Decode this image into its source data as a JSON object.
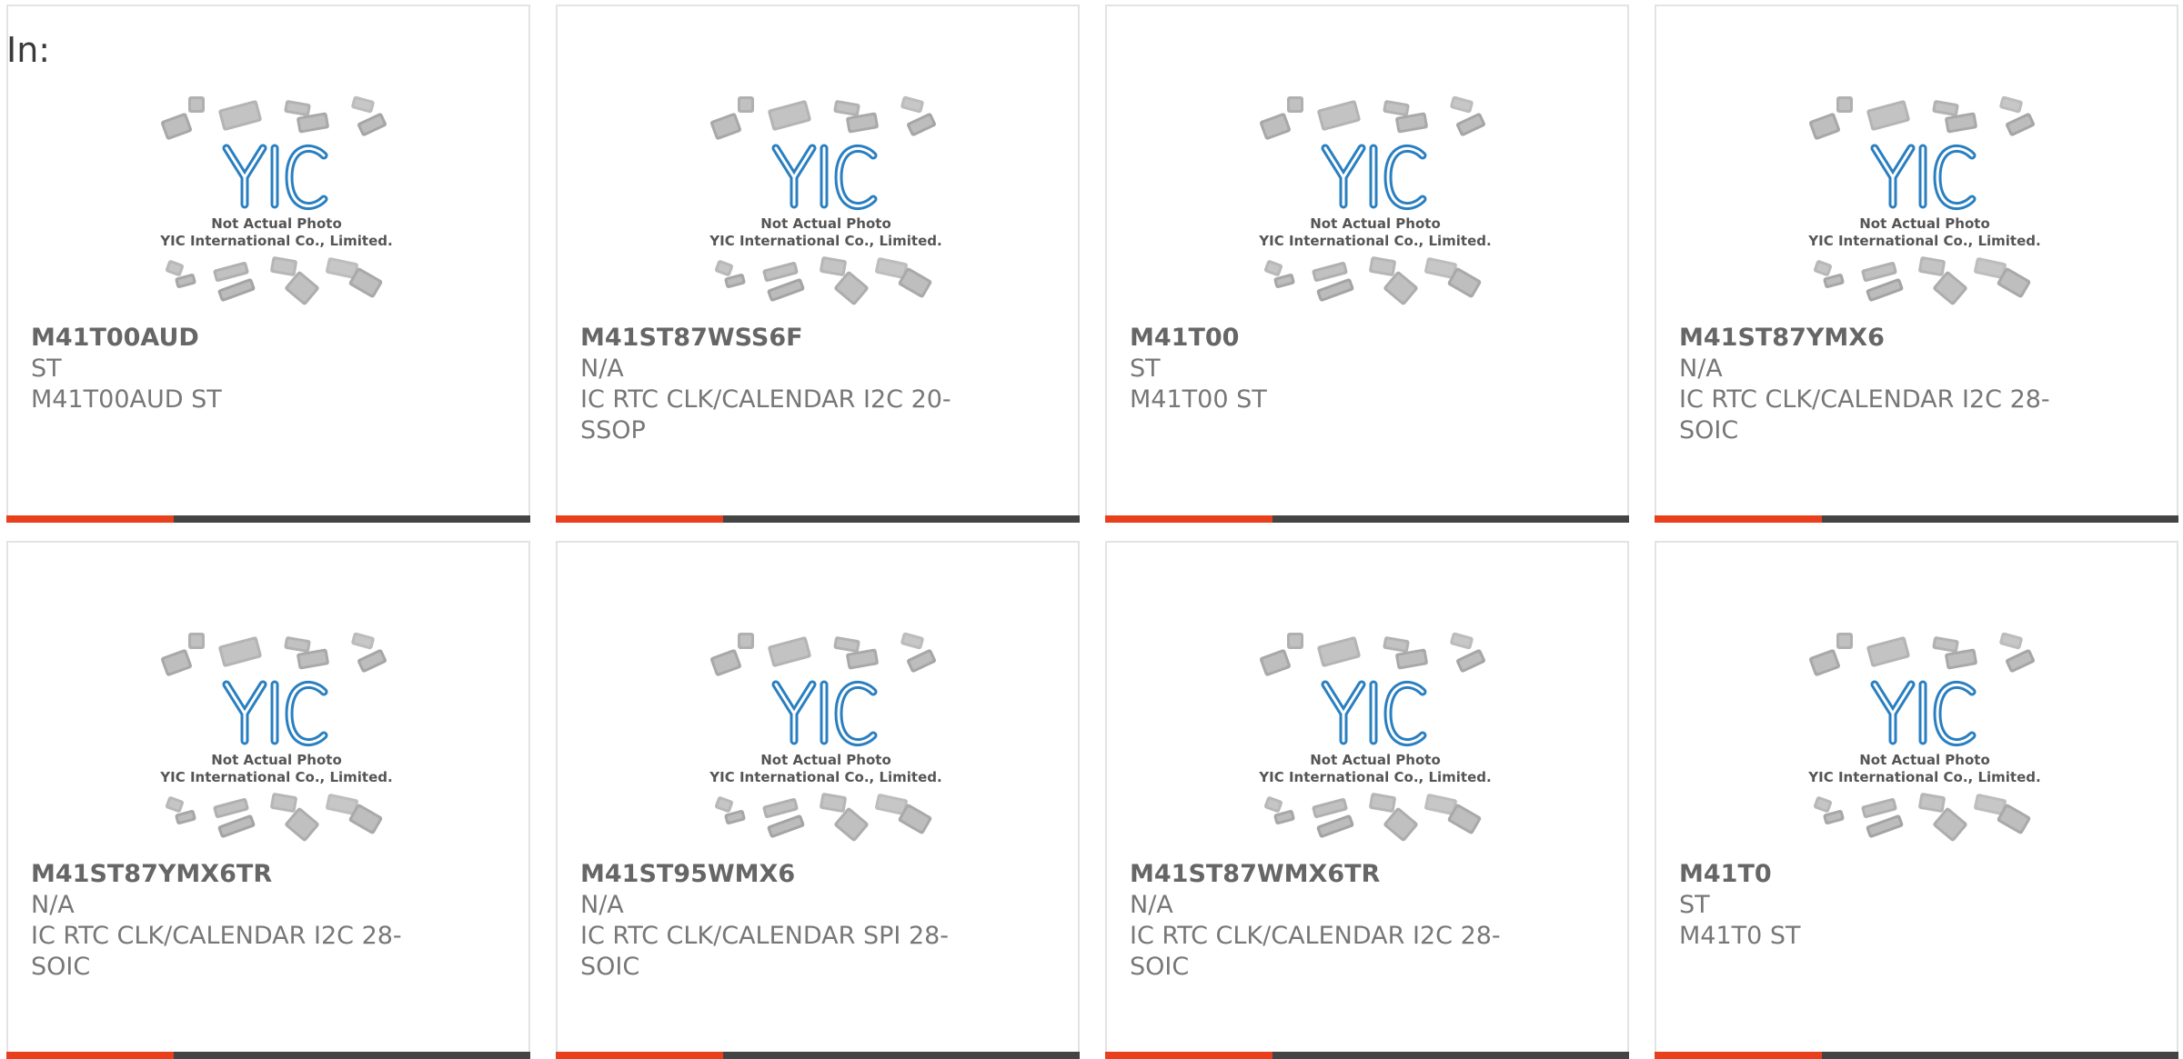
{
  "header": {
    "in_label": "In:"
  },
  "thumbnail": {
    "line1": "Not Actual Photo",
    "line2": "YIC International Co., Limited.",
    "logo_color": "#2a7fc0"
  },
  "colors": {
    "accent": "#e8401c",
    "bar": "#444444"
  },
  "products": [
    {
      "part": "M41T00AUD",
      "brand": "ST",
      "desc": "M41T00AUD ST"
    },
    {
      "part": "M41ST87WSS6F",
      "brand": "N/A",
      "desc": "IC RTC CLK/CALENDAR I2C 20-SSOP"
    },
    {
      "part": "M41T00",
      "brand": "ST",
      "desc": "M41T00 ST"
    },
    {
      "part": "M41ST87YMX6",
      "brand": "N/A",
      "desc": "IC RTC CLK/CALENDAR I2C 28-SOIC"
    },
    {
      "part": "M41ST87YMX6TR",
      "brand": "N/A",
      "desc": "IC RTC CLK/CALENDAR I2C 28-SOIC"
    },
    {
      "part": "M41ST95WMX6",
      "brand": "N/A",
      "desc": "IC RTC CLK/CALENDAR SPI 28-SOIC"
    },
    {
      "part": "M41ST87WMX6TR",
      "brand": "N/A",
      "desc": "IC RTC CLK/CALENDAR I2C 28-SOIC"
    },
    {
      "part": "M41T0",
      "brand": "ST",
      "desc": "M41T0 ST"
    }
  ]
}
